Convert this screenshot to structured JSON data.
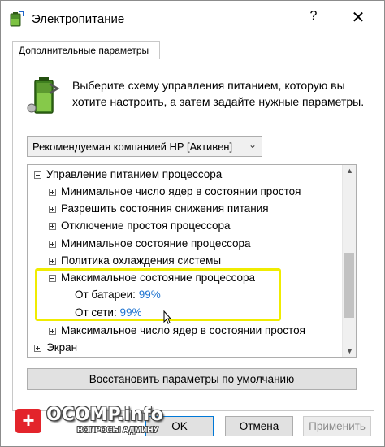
{
  "window": {
    "title": "Электропитание",
    "help_glyph": "?",
    "close_glyph": "✕"
  },
  "tab": {
    "label": "Дополнительные параметры"
  },
  "intro": {
    "text": "Выберите схему управления питанием, которую вы хотите настроить, а затем задайте нужные параметры."
  },
  "plan_select": {
    "value": "Рекомендуемая компанией HP [Активен]"
  },
  "tree": {
    "rows": [
      {
        "label": "Управление питанием процессора",
        "expander": "minus"
      },
      {
        "label": "Минимальное число ядер в состоянии простоя",
        "expander": "plus"
      },
      {
        "label": "Разрешить состояния снижения питания",
        "expander": "plus"
      },
      {
        "label": "Отключение простоя процессора",
        "expander": "plus"
      },
      {
        "label": "Минимальное состояние процессора",
        "expander": "plus"
      },
      {
        "label": "Политика охлаждения системы",
        "expander": "plus"
      },
      {
        "label": "Максимальное состояние процессора",
        "expander": "minus"
      },
      {
        "label": "От батареи:",
        "value": "99%"
      },
      {
        "label": "От сети:",
        "value": "99%"
      },
      {
        "label": "Максимальное число ядер в состоянии простоя",
        "expander": "plus"
      },
      {
        "label": "Экран",
        "expander": "plus"
      }
    ]
  },
  "buttons": {
    "restore": "Восстановить параметры по умолчанию",
    "ok": "OK",
    "cancel": "Отмена",
    "apply": "Применить"
  },
  "watermark": {
    "badge": "+",
    "brand": "OCOMP.info",
    "sub": "ВОПРОСЫ АДМИНУ"
  },
  "colors": {
    "value_link": "#1e73d0",
    "highlight": "#f0ec00",
    "ok_border": "#0078d7"
  }
}
